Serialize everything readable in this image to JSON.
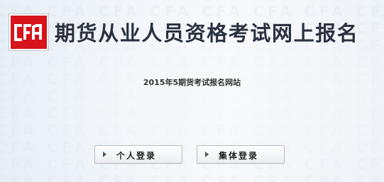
{
  "header": {
    "title": "期货从业人员资格考试网上报名",
    "logo_text": "CFA"
  },
  "subtitle": "2015年5期货考试报名网站",
  "buttons": {
    "personal_login": "个人登录",
    "group_login": "集体登录"
  },
  "colors": {
    "logo_red": "#d7141b",
    "title": "#2a3240"
  }
}
